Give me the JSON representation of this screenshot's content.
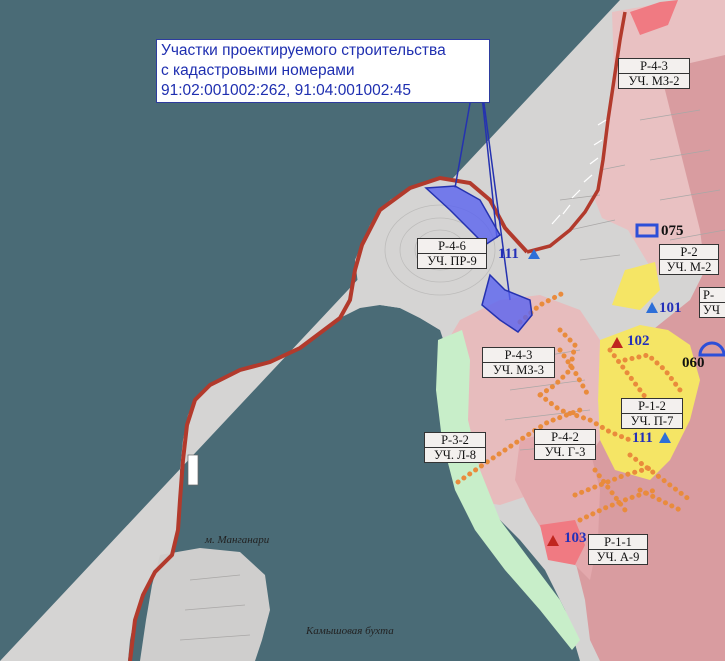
{
  "callout": {
    "lines": [
      "Участки проектируемого строительства",
      "с кадастровыми номерами",
      "91:02:001002:262, 91:04:001002:45"
    ]
  },
  "zones": [
    {
      "top": "Р-4-3",
      "bottom": "УЧ. МЗ-2"
    },
    {
      "top": "Р-4-6",
      "bottom": "УЧ. ПР-9"
    },
    {
      "top": "Р-2",
      "bottom": "УЧ. М-2"
    },
    {
      "top": "Р-",
      "bottom": "УЧ"
    },
    {
      "top": "Р-4-3",
      "bottom": "УЧ. МЗ-3"
    },
    {
      "top": "Р-1-2",
      "bottom": "УЧ. П-7"
    },
    {
      "top": "Р-3-2",
      "bottom": "УЧ. Л-8"
    },
    {
      "top": "Р-4-2",
      "bottom": "УЧ. Г-3"
    },
    {
      "top": "Р-1-1",
      "bottom": "УЧ. А-9"
    }
  ],
  "markers": [
    {
      "label": "111",
      "color": "blue"
    },
    {
      "label": "075",
      "color": "black"
    },
    {
      "label": "101",
      "color": "blue"
    },
    {
      "label": "102",
      "color": "blue"
    },
    {
      "label": "060",
      "color": "black"
    },
    {
      "label": "111",
      "color": "blue"
    },
    {
      "label": "103",
      "color": "blue"
    }
  ],
  "places": {
    "cape": "м. Манганари",
    "bay": "Камышовая бухта"
  },
  "colors": {
    "water": "#4a6b76",
    "land": "#d5d4d3",
    "pink_zone": "#e9c1c2",
    "red_zone": "#d99ca0",
    "yellow_zone": "#f5e565",
    "green_zone": "#c8eec9",
    "boundary": "#b23a2c",
    "project_site": "#5a63f0",
    "orange_dots": "#e98b3c"
  },
  "icons": [
    "triangle-marker-icon",
    "rectangle-marker-icon",
    "semicircle-marker-icon"
  ]
}
